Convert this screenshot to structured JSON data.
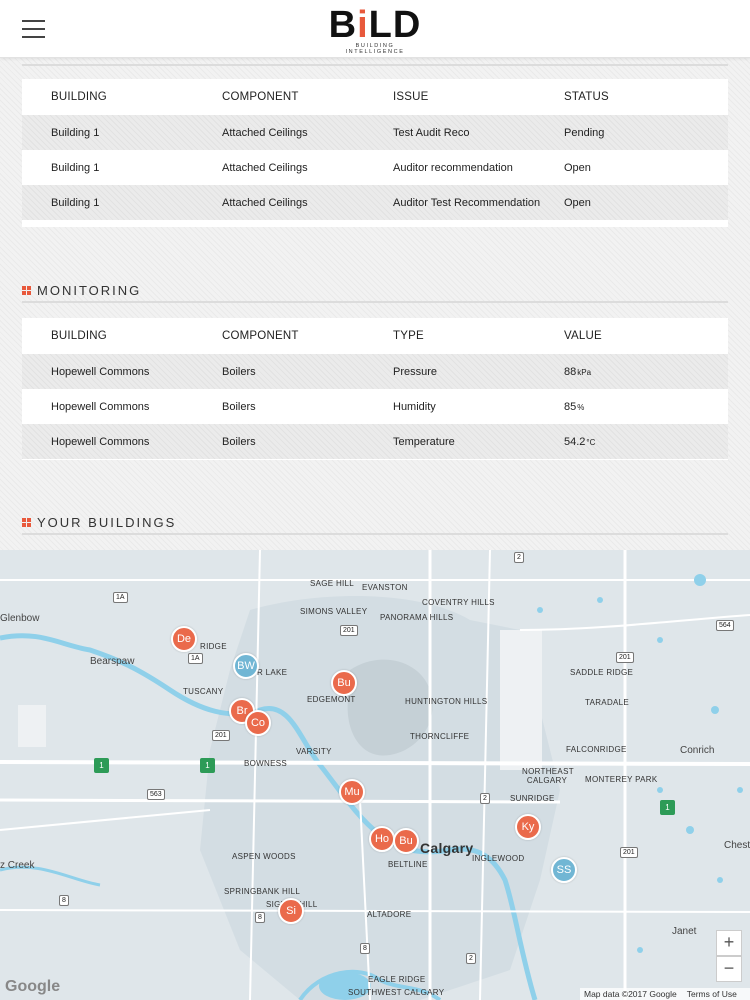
{
  "header": {
    "logo_text_b": "B",
    "logo_text_i": "i",
    "logo_text_ld": "LD",
    "logo_tagline": "BUILDING INTELLIGENCE"
  },
  "recommendations": {
    "columns": [
      "BUILDING",
      "COMPONENT",
      "ISSUE",
      "STATUS"
    ],
    "rows": [
      [
        "Building 1",
        "Attached Ceilings",
        "Test Audit Reco",
        "Pending"
      ],
      [
        "Building 1",
        "Attached Ceilings",
        "Auditor recommendation",
        "Open"
      ],
      [
        "Building 1",
        "Attached Ceilings",
        "Auditor Test Recommendation",
        "Open"
      ]
    ]
  },
  "monitoring": {
    "title": "MONITORING",
    "columns": [
      "BUILDING",
      "COMPONENT",
      "TYPE",
      "VALUE"
    ],
    "rows": [
      {
        "building": "Hopewell Commons",
        "component": "Boilers",
        "type": "Pressure",
        "value": "88",
        "unit": "kPa"
      },
      {
        "building": "Hopewell Commons",
        "component": "Boilers",
        "type": "Humidity",
        "value": "85",
        "unit": "%"
      },
      {
        "building": "Hopewell Commons",
        "component": "Boilers",
        "type": "Temperature",
        "value": "54.2",
        "unit": "°C"
      }
    ]
  },
  "buildings": {
    "title": "YOUR BUILDINGS",
    "map": {
      "city": "Calgary",
      "labels": [
        "Glenbow",
        "Bearspaw",
        "SAGE HILL",
        "EVANSTON",
        "COVENTRY HILLS",
        "SIMONS VALLEY",
        "PANORAMA HILLS",
        "RIDGE",
        "SADDLE RIDGE",
        "TUSCANY",
        "EDGEMONT",
        "HUNTINGTON HILLS",
        "TARADALE",
        "THORNCLIFFE",
        "FALCONRIDGE",
        "VARSITY",
        "BOWNESS",
        "Conrich",
        "NORTHEAST CALGARY",
        "MONTEREY PARK",
        "SUNRIDGE",
        "ASPEN WOODS",
        "BELTLINE",
        "INGLEWOOD",
        "SPRINGBANK HILL",
        "SIGNAL HILL",
        "ALTADORE",
        "Janet",
        "EAGLE RIDGE",
        "SOUTHWEST CALGARY",
        "z Creek",
        "Chestermere",
        "R LAKE"
      ],
      "pins": [
        {
          "label": "De",
          "color": "orange"
        },
        {
          "label": "BW",
          "color": "blue"
        },
        {
          "label": "Bu",
          "color": "orange"
        },
        {
          "label": "Br",
          "color": "orange"
        },
        {
          "label": "Co",
          "color": "orange"
        },
        {
          "label": "Mu",
          "color": "orange"
        },
        {
          "label": "Ho",
          "color": "orange"
        },
        {
          "label": "Bu",
          "color": "orange"
        },
        {
          "label": "Ky",
          "color": "orange"
        },
        {
          "label": "SS",
          "color": "blue"
        },
        {
          "label": "Si",
          "color": "orange"
        }
      ],
      "zoom_in": "+",
      "zoom_out": "−",
      "google": "Google",
      "attribution": "Map data ©2017 Google",
      "terms": "Terms of Use"
    }
  },
  "colors": {
    "accent": "#e8593c",
    "pin_orange": "#ea6a4b",
    "pin_blue": "#71b6d4",
    "water": "#8fd0ea"
  },
  "icons": {
    "menu": "hamburger-menu-icon",
    "section": "grid-icon"
  }
}
